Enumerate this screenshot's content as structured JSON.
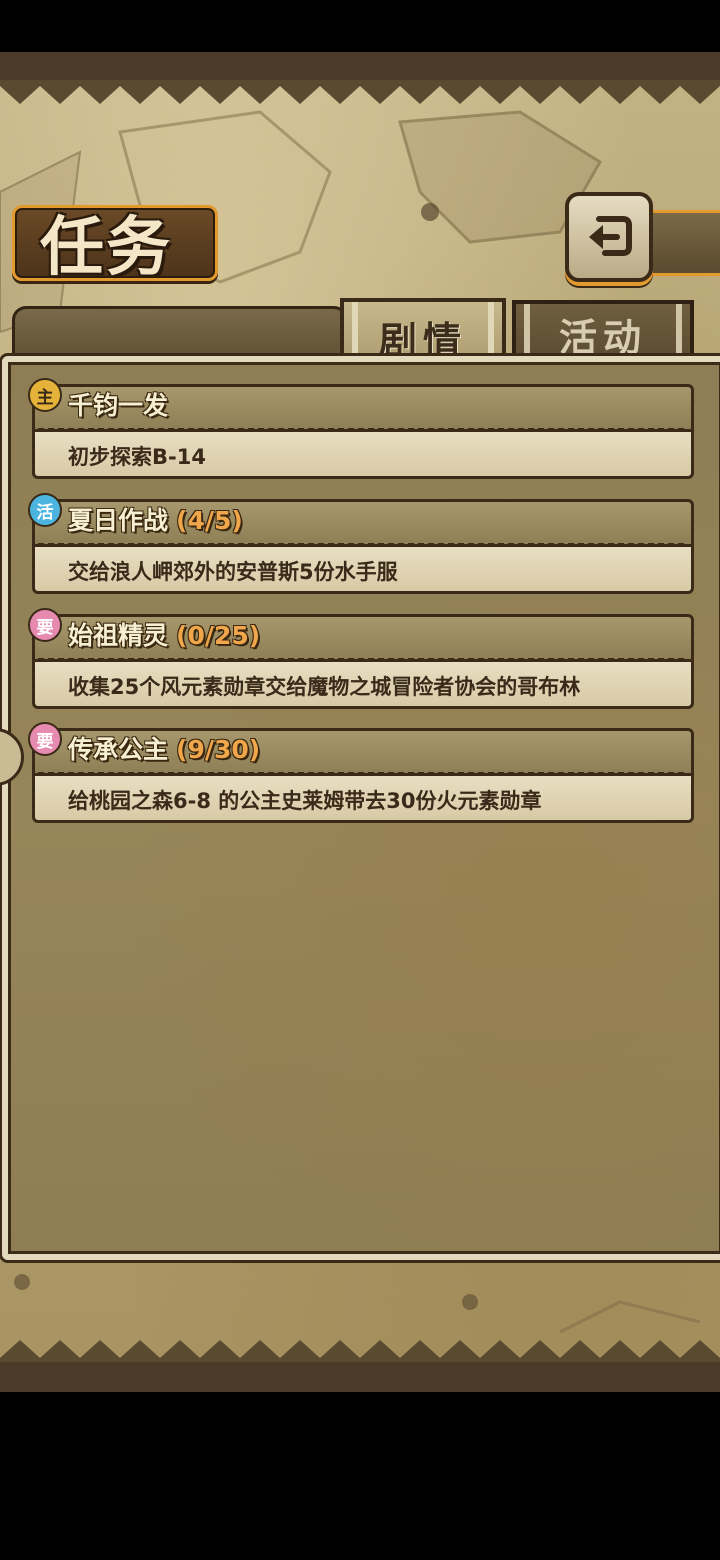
{
  "header": {
    "title": "任务",
    "back_icon": "back-arrow-icon"
  },
  "tabs": [
    {
      "label": "剧情",
      "selected": true
    },
    {
      "label": "活动",
      "selected": false
    }
  ],
  "quests": [
    {
      "badge": "主",
      "badge_type": "main",
      "title": "千钧一发",
      "progress": "",
      "description": "初步探索B-14"
    },
    {
      "badge": "活",
      "badge_type": "active",
      "title": "夏日作战",
      "progress": "(4/5)",
      "description": "交给浪人岬郊外的安普斯5份水手服"
    },
    {
      "badge": "要",
      "badge_type": "need",
      "title": "始祖精灵",
      "progress": "(0/25)",
      "description": "收集25个风元素勋章交给魔物之城冒险者协会的哥布林"
    },
    {
      "badge": "要",
      "badge_type": "need",
      "title": "传承公主",
      "progress": "(9/30)",
      "description": "给桃园之森6-8 的公主史莱姆带去30份火元素勋章"
    }
  ],
  "colors": {
    "accent_orange": "#e29a2e",
    "progress_orange": "#f0a64a",
    "badge_main": "#e5b23a",
    "badge_active": "#4bb5df",
    "badge_need": "#e68ab0"
  }
}
